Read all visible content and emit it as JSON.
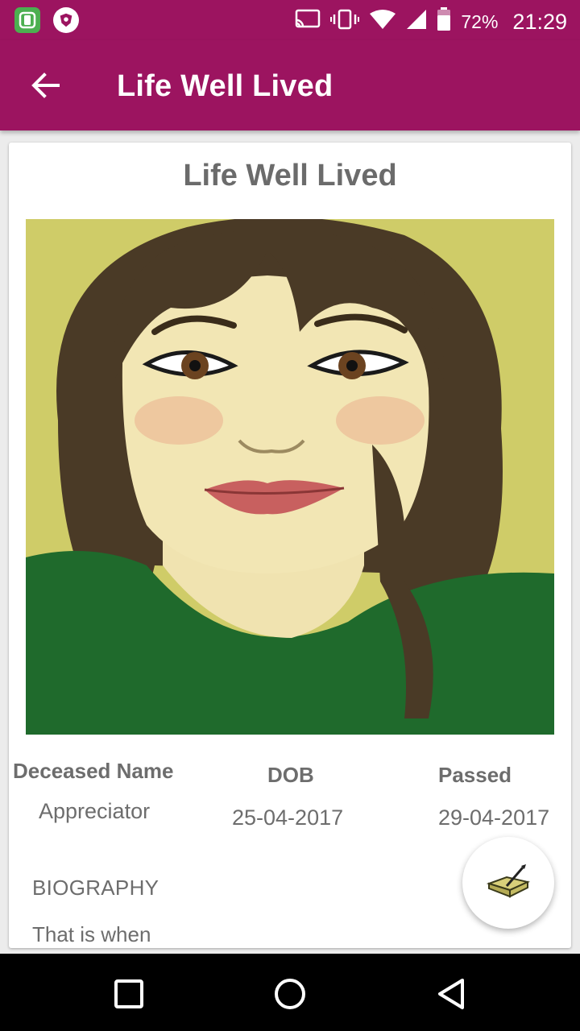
{
  "status_bar": {
    "battery_percent": "72%",
    "time": "21:29",
    "icons": [
      "app-notification-icon",
      "shield-app-icon",
      "cast-icon",
      "vibrate-icon",
      "wifi-icon",
      "signal-icon",
      "battery-icon"
    ]
  },
  "app_bar": {
    "title": "Life Well Lived",
    "back_icon": "arrow-back-icon"
  },
  "card": {
    "title": "Life Well Lived",
    "portrait_alt": "illustrated portrait",
    "fields": {
      "name_label": "Deceased Name",
      "name_value": "Appreciator",
      "dob_label": "DOB",
      "dob_value": "25-04-2017",
      "passed_label": "Passed",
      "passed_value": "29-04-2017"
    },
    "biography_heading": "BIOGRAPHY",
    "biography_text": "That is when"
  },
  "fab": {
    "icon": "guestbook-pen-icon"
  },
  "nav_bar": {
    "buttons": [
      "recents-square-icon",
      "home-circle-icon",
      "back-triangle-icon"
    ]
  },
  "colors": {
    "primary": "#9c1460",
    "text_secondary": "#6d6d6d",
    "portrait_bg": "#cfcc68"
  }
}
